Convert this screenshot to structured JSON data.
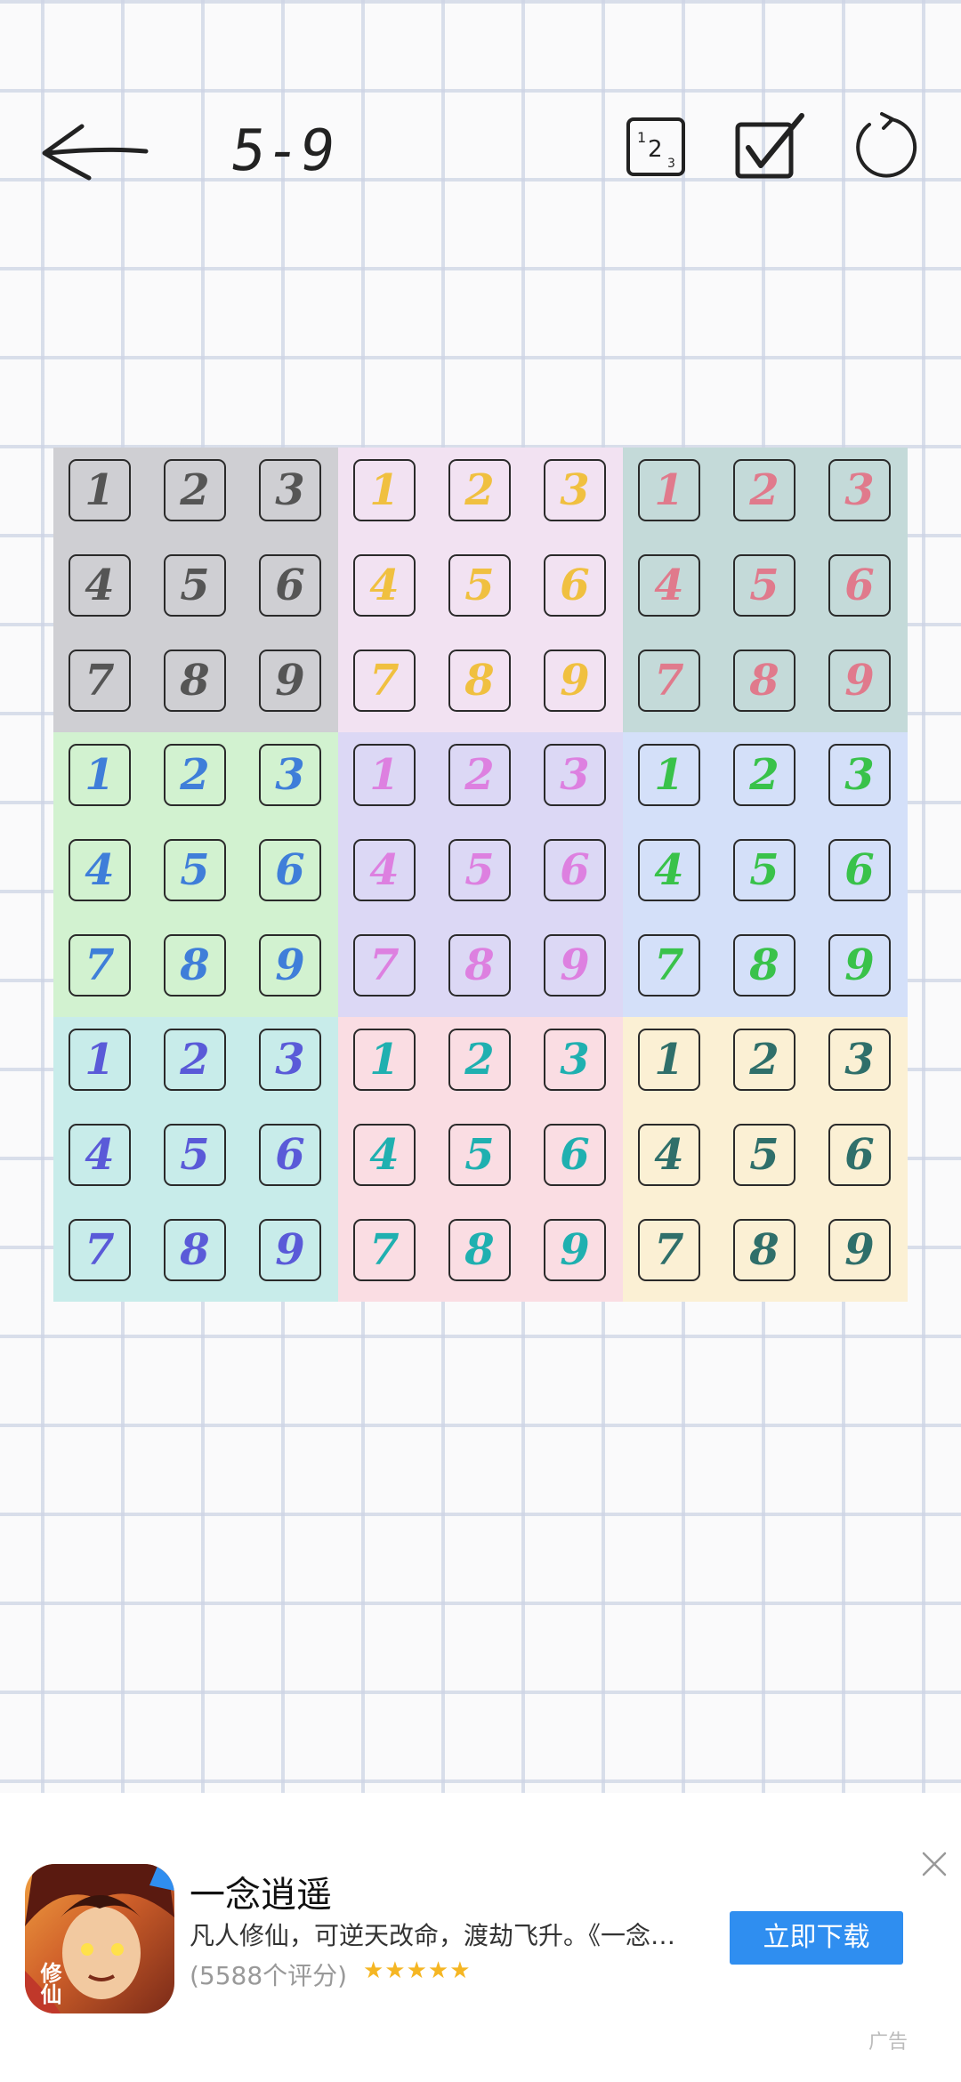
{
  "header": {
    "back_icon": "arrow-left-icon",
    "level": "5-9",
    "icons": [
      "number-hint-icon",
      "check-icon",
      "restart-icon"
    ]
  },
  "board": {
    "boxes": [
      {
        "bg": "#cfcfd3",
        "ink": "#555555",
        "cells": [
          "1",
          "2",
          "3",
          "4",
          "5",
          "6",
          "7",
          "8",
          "9"
        ]
      },
      {
        "bg": "#f2e2f2",
        "ink": "#f0c040",
        "cells": [
          "1",
          "2",
          "3",
          "4",
          "5",
          "6",
          "7",
          "8",
          "9"
        ]
      },
      {
        "bg": "#c4dad9",
        "ink": "#e07a8c",
        "cells": [
          "1",
          "2",
          "3",
          "4",
          "5",
          "6",
          "7",
          "8",
          "9"
        ]
      },
      {
        "bg": "#d2f2d0",
        "ink": "#3f7ed9",
        "cells": [
          "1",
          "2",
          "3",
          "4",
          "5",
          "6",
          "7",
          "8",
          "9"
        ]
      },
      {
        "bg": "#dcd8f5",
        "ink": "#dd80e0",
        "cells": [
          "1",
          "2",
          "3",
          "4",
          "5",
          "6",
          "7",
          "8",
          "9"
        ]
      },
      {
        "bg": "#d4e0f9",
        "ink": "#39c24a",
        "cells": [
          "1",
          "2",
          "3",
          "4",
          "5",
          "6",
          "7",
          "8",
          "9"
        ]
      },
      {
        "bg": "#c8ecea",
        "ink": "#5a5ad8",
        "cells": [
          "1",
          "2",
          "3",
          "4",
          "5",
          "6",
          "7",
          "8",
          "9"
        ]
      },
      {
        "bg": "#fadde3",
        "ink": "#1fb0b0",
        "cells": [
          "1",
          "2",
          "3",
          "4",
          "5",
          "6",
          "7",
          "8",
          "9"
        ]
      },
      {
        "bg": "#fbf0d4",
        "ink": "#2f6f6a",
        "cells": [
          "1",
          "2",
          "3",
          "4",
          "5",
          "6",
          "7",
          "8",
          "9"
        ]
      }
    ]
  },
  "ad": {
    "title": "一念逍遥",
    "description": "凡人修仙，可逆天改命，渡劫飞升。《一念…",
    "rating": "(5588个评分)",
    "stars": "★★★★★",
    "button": "立即下载",
    "icon_text": "修仙",
    "tag": "广告"
  }
}
